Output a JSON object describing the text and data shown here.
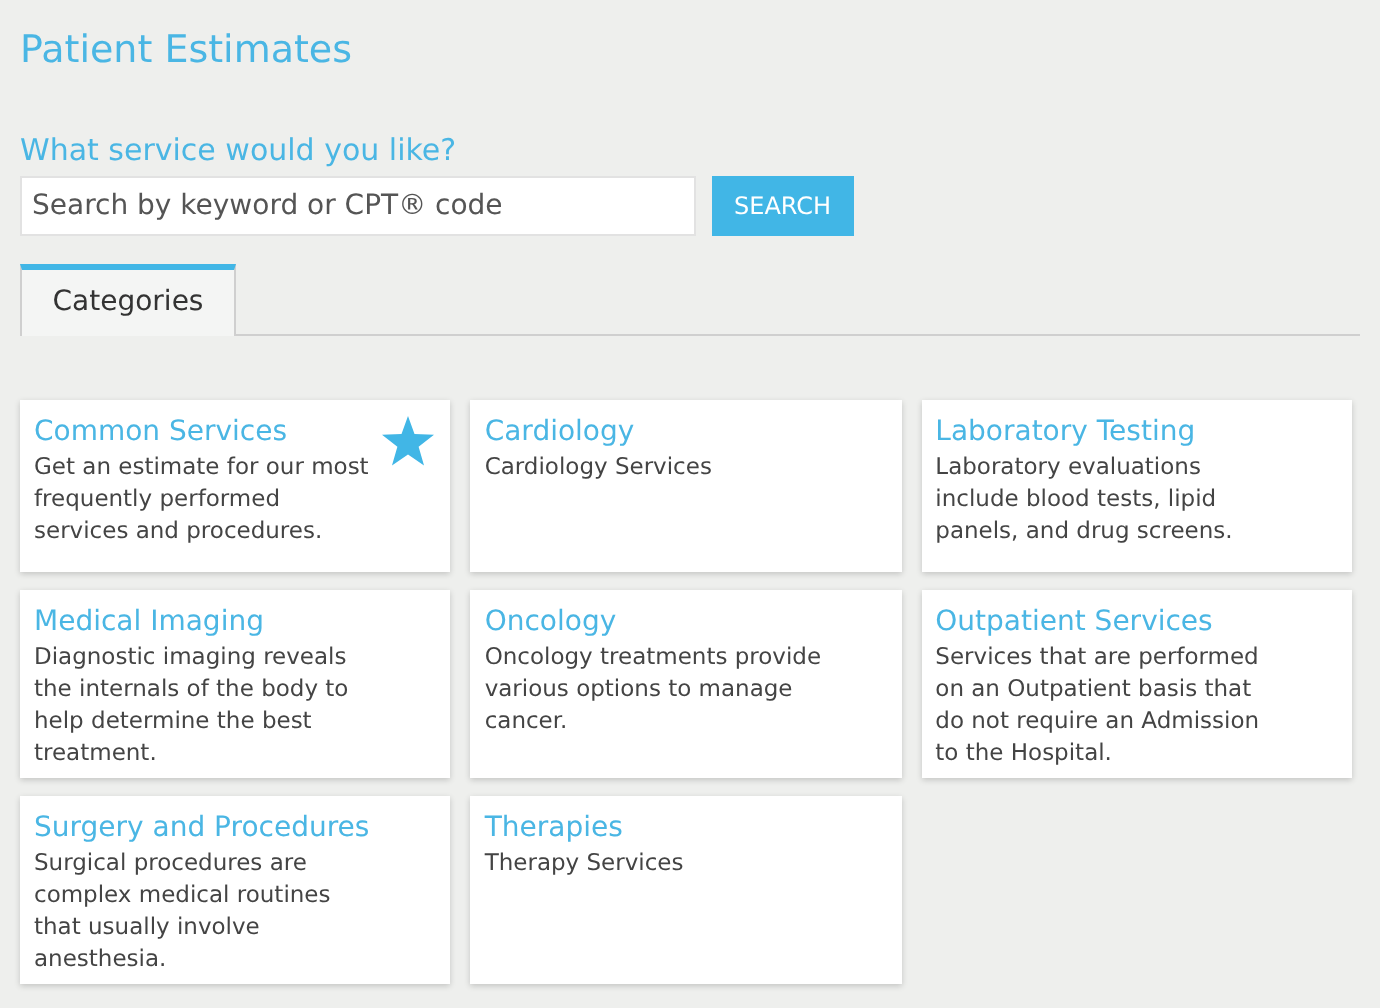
{
  "page_title": "Patient Estimates",
  "search": {
    "heading": "What service would you like?",
    "placeholder": "Search by keyword or CPT® code",
    "button": "SEARCH"
  },
  "tabs": [
    {
      "label": "Categories",
      "selected": true
    }
  ],
  "categories": [
    {
      "title": "Common Services",
      "description": "Get an estimate for our most frequently performed services and procedures.",
      "featured": true
    },
    {
      "title": "Cardiology",
      "description": "Cardiology Services",
      "featured": false
    },
    {
      "title": "Laboratory Testing",
      "description": "Laboratory evaluations include blood tests, lipid panels, and drug screens.",
      "featured": false
    },
    {
      "title": "Medical Imaging",
      "description": "Diagnostic imaging reveals the internals of the body to help determine the best treatment.",
      "featured": false
    },
    {
      "title": "Oncology",
      "description": "Oncology treatments provide various options to manage cancer.",
      "featured": false
    },
    {
      "title": "Outpatient Services",
      "description": "Services that are performed on an Outpatient basis that do not require an Admission to the Hospital.",
      "featured": false
    },
    {
      "title": "Surgery and Procedures",
      "description": "Surgical procedures are complex medical routines that usually involve anesthesia.",
      "featured": false
    },
    {
      "title": "Therapies",
      "description": "Therapy Services",
      "featured": false
    }
  ]
}
